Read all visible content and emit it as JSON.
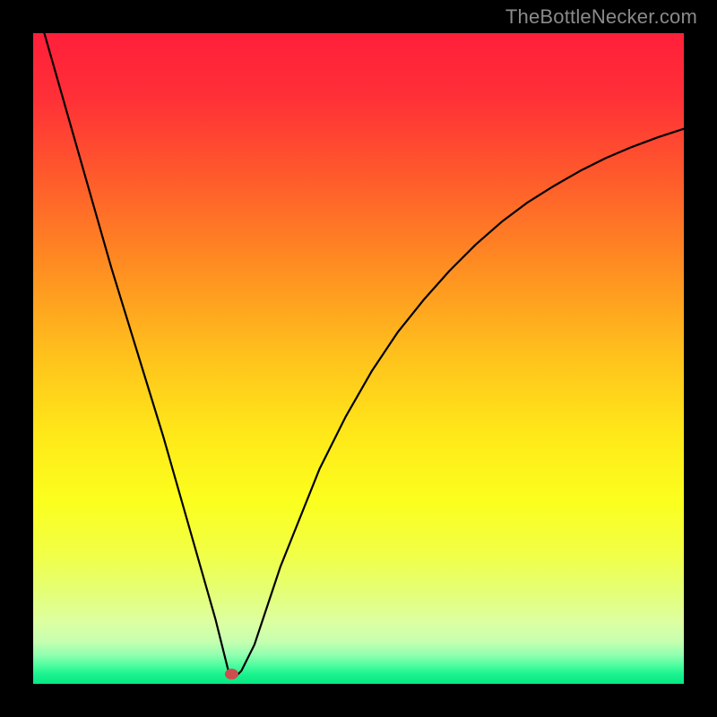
{
  "watermark": "TheBottleNecker.com",
  "chart_data": {
    "type": "line",
    "title": "",
    "xlabel": "",
    "ylabel": "",
    "xlim": [
      0,
      100
    ],
    "ylim": [
      0,
      100
    ],
    "series": [
      {
        "name": "bottleneck-curve",
        "x": [
          0,
          4,
          8,
          12,
          16,
          20,
          24,
          26,
          28,
          29,
          30,
          31,
          32,
          34,
          36,
          38,
          40,
          44,
          48,
          52,
          56,
          60,
          64,
          68,
          72,
          76,
          80,
          84,
          88,
          92,
          96,
          100
        ],
        "y": [
          106,
          92,
          78,
          64,
          51,
          38,
          24,
          17,
          10,
          6,
          2,
          1,
          2,
          6,
          12,
          18,
          23,
          33,
          41,
          48,
          54,
          59,
          63.5,
          67.5,
          71,
          74,
          76.5,
          78.8,
          80.8,
          82.5,
          84,
          85.3
        ]
      }
    ],
    "marker": {
      "x": 30.5,
      "y": 1.5,
      "color": "#cc4e4e"
    },
    "gradient_stops": [
      {
        "offset": 0.0,
        "color": "#ff1f3a"
      },
      {
        "offset": 0.1,
        "color": "#ff3037"
      },
      {
        "offset": 0.22,
        "color": "#ff5a2c"
      },
      {
        "offset": 0.35,
        "color": "#ff8a22"
      },
      {
        "offset": 0.5,
        "color": "#ffc31c"
      },
      {
        "offset": 0.62,
        "color": "#ffe919"
      },
      {
        "offset": 0.72,
        "color": "#fbff1e"
      },
      {
        "offset": 0.8,
        "color": "#f1ff46"
      },
      {
        "offset": 0.86,
        "color": "#e4ff77"
      },
      {
        "offset": 0.905,
        "color": "#ddffa1"
      },
      {
        "offset": 0.935,
        "color": "#c6ffb0"
      },
      {
        "offset": 0.955,
        "color": "#93ffb0"
      },
      {
        "offset": 0.972,
        "color": "#4cfd9f"
      },
      {
        "offset": 0.985,
        "color": "#1bf38f"
      },
      {
        "offset": 1.0,
        "color": "#06e884"
      }
    ]
  }
}
